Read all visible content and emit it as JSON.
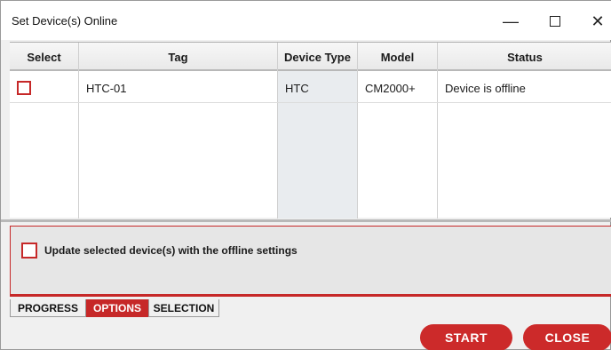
{
  "window": {
    "title": "Set Device(s) Online",
    "min_glyph": "—",
    "close_glyph": "✕"
  },
  "grid": {
    "columns": [
      "Select",
      "Tag",
      "Device Type",
      "Model",
      "Status"
    ],
    "rows": [
      {
        "selected": false,
        "tag": "HTC-01",
        "device_type": "HTC",
        "model": "CM2000+",
        "status": "Device is offline"
      }
    ]
  },
  "options": {
    "update_offline_label": "Update selected device(s) with the offline settings",
    "update_offline_checked": false
  },
  "tabs": [
    {
      "label": "PROGRESS",
      "active": false
    },
    {
      "label": "OPTIONS",
      "active": true
    },
    {
      "label": "SELECTION",
      "active": false
    }
  ],
  "buttons": {
    "start_label": "START",
    "close_label": "CLOSE"
  },
  "colors": {
    "accent": "#cc2a2a",
    "device_type_col": "#e9ecef"
  }
}
